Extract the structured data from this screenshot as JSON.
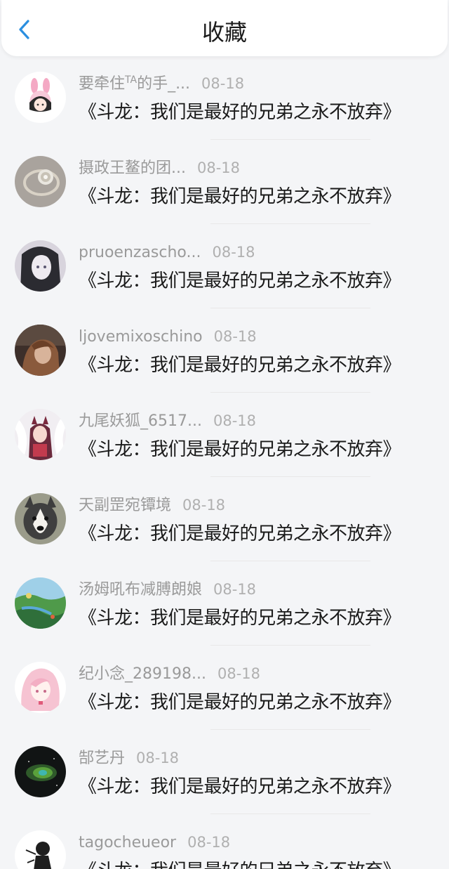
{
  "header": {
    "title": "收藏",
    "back_icon": "chevron-left-icon",
    "accent": "#2b8fe0"
  },
  "items": [
    {
      "user": "要牵住TA的手_...",
      "date": "08-18",
      "text": "《斗龙：我们是最好的兄弟之永不放弃》",
      "avatar_icon": "pink-bunny-avatar"
    },
    {
      "user": "摄政王鳌的团...",
      "date": "08-18",
      "text": "《斗龙：我们是最好的兄弟之永不放弃》",
      "avatar_icon": "ring-avatar"
    },
    {
      "user": "pruoenzascho...",
      "date": "08-18",
      "text": "《斗龙：我们是最好的兄弟之永不放弃》",
      "avatar_icon": "anime-girl-avatar"
    },
    {
      "user": "ljovemixoschino",
      "date": "08-18",
      "text": "《斗龙：我们是最好的兄弟之永不放弃》",
      "avatar_icon": "photo-girl-avatar"
    },
    {
      "user": "九尾妖狐_6517...",
      "date": "08-18",
      "text": "《斗龙：我们是最好的兄弟之永不放弃》",
      "avatar_icon": "fox-girl-avatar"
    },
    {
      "user": "天副罡宛镡境",
      "date": "08-18",
      "text": "《斗龙：我们是最好的兄弟之永不放弃》",
      "avatar_icon": "husky-dog-avatar"
    },
    {
      "user": "汤姆吼布减膊朗娘",
      "date": "08-18",
      "text": "《斗龙：我们是最好的兄弟之永不放弃》",
      "avatar_icon": "landscape-avatar"
    },
    {
      "user": "纪小念_289198...",
      "date": "08-18",
      "text": "《斗龙：我们是最好的兄弟之永不放弃》",
      "avatar_icon": "pink-hair-avatar"
    },
    {
      "user": "郜艺丹",
      "date": "08-18",
      "text": "《斗龙：我们是最好的兄弟之永不放弃》",
      "avatar_icon": "nebula-avatar"
    },
    {
      "user": "tagocheueor",
      "date": "08-18",
      "text": "《斗龙：我们是最好的兄弟之永不放弃》",
      "avatar_icon": "sketch-avatar"
    }
  ]
}
